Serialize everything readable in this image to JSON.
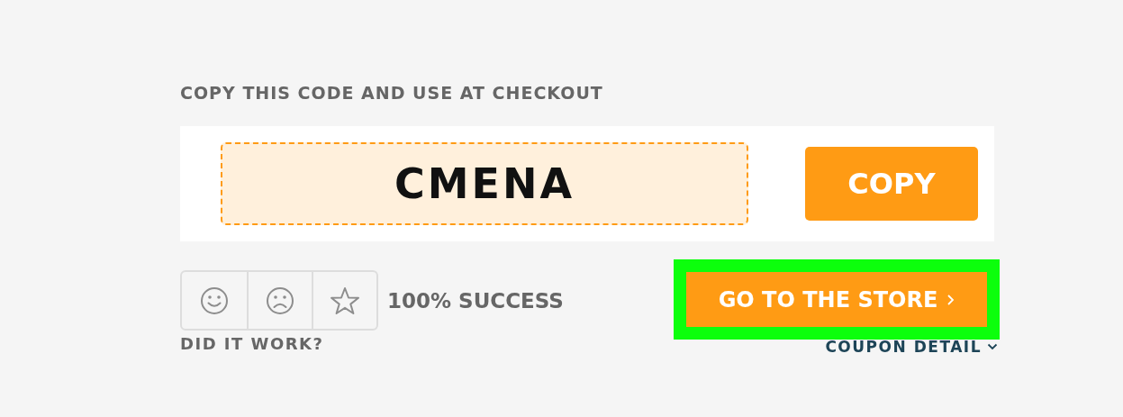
{
  "heading": "COPY THIS CODE AND USE AT CHECKOUT",
  "code": "CMENA",
  "copy_button": {
    "label": "COPY"
  },
  "feedback": {
    "options": [
      {
        "kind": "smile"
      },
      {
        "kind": "frown"
      },
      {
        "kind": "star"
      }
    ],
    "success": "100% SUCCESS",
    "question": "DID IT WORK?"
  },
  "store_button": {
    "label": "GO TO THE STORE",
    "highlighted": true
  },
  "coupon_detail": {
    "label": "COUPON DETAIL"
  }
}
